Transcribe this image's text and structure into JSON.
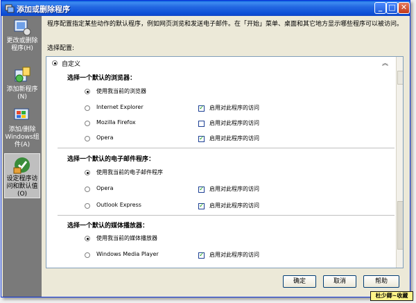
{
  "window": {
    "title": "添加或删除程序"
  },
  "sidebar": {
    "items": [
      {
        "label": "更改或删除程序(H)",
        "icon": "change-remove-icon"
      },
      {
        "label": "添加新程序(N)",
        "icon": "add-new-icon"
      },
      {
        "label": "添加/删除Windows组件(A)",
        "icon": "windows-components-icon"
      },
      {
        "label": "设定程序访问和默认值(O)",
        "icon": "program-access-icon"
      }
    ]
  },
  "main": {
    "description": "程序配置指定某些动作的默认程序，例如网页浏览和发送电子邮件。在「开始」菜单、桌面和其它地方显示哪些程序可以被访问。",
    "config_label": "选择配置:",
    "config_selected": "自定义",
    "sections": [
      {
        "title": "选择一个默认的浏览器：",
        "current": "使用我当前的浏览器",
        "options": [
          {
            "name": "Internet Explorer",
            "access": true
          },
          {
            "name": "Mozilla Firefox",
            "access": false
          },
          {
            "name": "Opera",
            "access": true
          }
        ]
      },
      {
        "title": "选择一个默认的电子邮件程序：",
        "current": "使用我当前的电子邮件程序",
        "options": [
          {
            "name": "Opera",
            "access": true
          },
          {
            "name": "Outlook Express",
            "access": true
          }
        ]
      },
      {
        "title": "选择一个默认的媒体播放器：",
        "current": "使用我当前的媒体播放器",
        "options": [
          {
            "name": "Windows Media Player",
            "access": true
          }
        ]
      }
    ],
    "access_label": "启用对此程序的访问"
  },
  "buttons": {
    "ok": "确定",
    "cancel": "取消",
    "help": "帮助"
  },
  "watermark": "杜少卿~收藏"
}
